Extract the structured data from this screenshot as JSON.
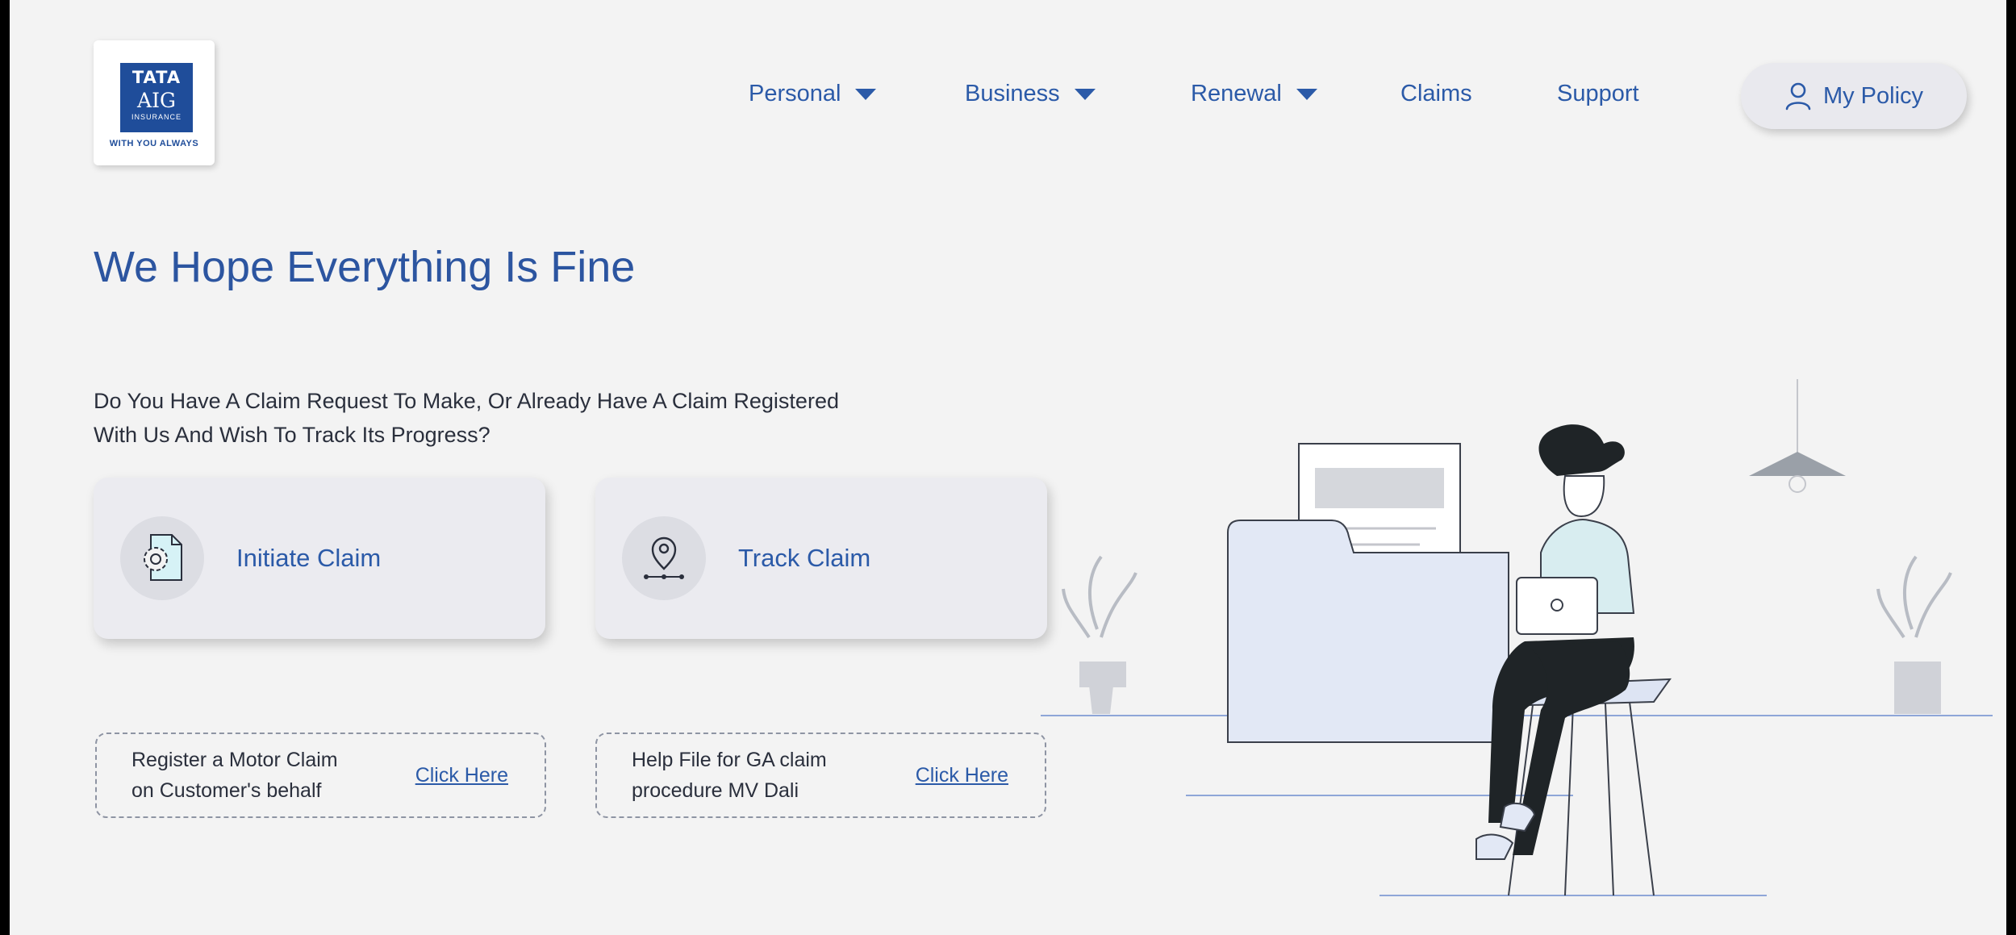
{
  "logo": {
    "line1": "TATA",
    "line2": "AIG",
    "line3": "INSURANCE",
    "tagline": "WITH YOU ALWAYS"
  },
  "nav": {
    "items": [
      {
        "label": "Personal",
        "has_dropdown": true
      },
      {
        "label": "Business",
        "has_dropdown": true
      },
      {
        "label": "Renewal",
        "has_dropdown": true
      },
      {
        "label": "Claims",
        "has_dropdown": false
      },
      {
        "label": "Support",
        "has_dropdown": false
      }
    ],
    "policy_button": {
      "label": "My Policy",
      "icon": "user-icon"
    }
  },
  "main": {
    "title": "We Hope Everything Is Fine",
    "question_line1": "Do You Have A Claim Request To Make, Or Already Have A Claim Registered",
    "question_line2": "With Us And Wish To Track Its Progress?",
    "cards": [
      {
        "label": "Initiate Claim",
        "icon": "document-gear-icon"
      },
      {
        "label": "Track Claim",
        "icon": "location-pin-icon"
      }
    ],
    "links": [
      {
        "text_line1": "Register a Motor Claim",
        "text_line2": "on Customer's behalf",
        "link": "Click Here"
      },
      {
        "text_line1": "Help File for GA claim",
        "text_line2": "procedure MV Dali",
        "link": "Click Here"
      }
    ]
  },
  "colors": {
    "brand": "#2b5aa8",
    "logo": "#1f4d9a",
    "background": "#f3f3f3"
  }
}
